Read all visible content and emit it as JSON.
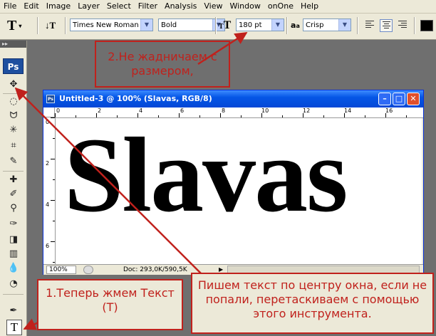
{
  "menubar": {
    "items": [
      "File",
      "Edit",
      "Image",
      "Layer",
      "Select",
      "Filter",
      "Analysis",
      "View",
      "Window",
      "onOne",
      "Help"
    ]
  },
  "options": {
    "tool_glyph": "T",
    "font_family": "Times New Roman",
    "font_style": "Bold",
    "size_glyph": "T",
    "font_size": "180 pt",
    "aa_glyph": "a",
    "aa_glyph2": "a",
    "antialias": "Crisp"
  },
  "toolbox": {
    "grip": "▸▸",
    "logo": "Ps",
    "type_tool": "T"
  },
  "document": {
    "title": "Untitled-3 @ 100% (Slavas, RGB/8)",
    "canvas_text": "Slavas",
    "zoom": "100%",
    "doc_info": "Doc: 293,0K/590,5K",
    "hruler_ticks": [
      "0",
      "2",
      "4",
      "6",
      "8",
      "10",
      "12",
      "14",
      "16"
    ],
    "vruler_ticks": [
      "0",
      "2",
      "4",
      "6"
    ]
  },
  "annotations": {
    "note_size": "2.Не жадничаем с размером,",
    "note_type_tool": "1.Теперь жмем Текст (T)",
    "note_center": "Пишем текст по центру окна, если не попали, перетаскиваем с помощью этого инструмента."
  },
  "colors": {
    "annotation_red": "#c0211c",
    "title_blue": "#0556e6",
    "workspace_gray": "#6f6f6f"
  }
}
